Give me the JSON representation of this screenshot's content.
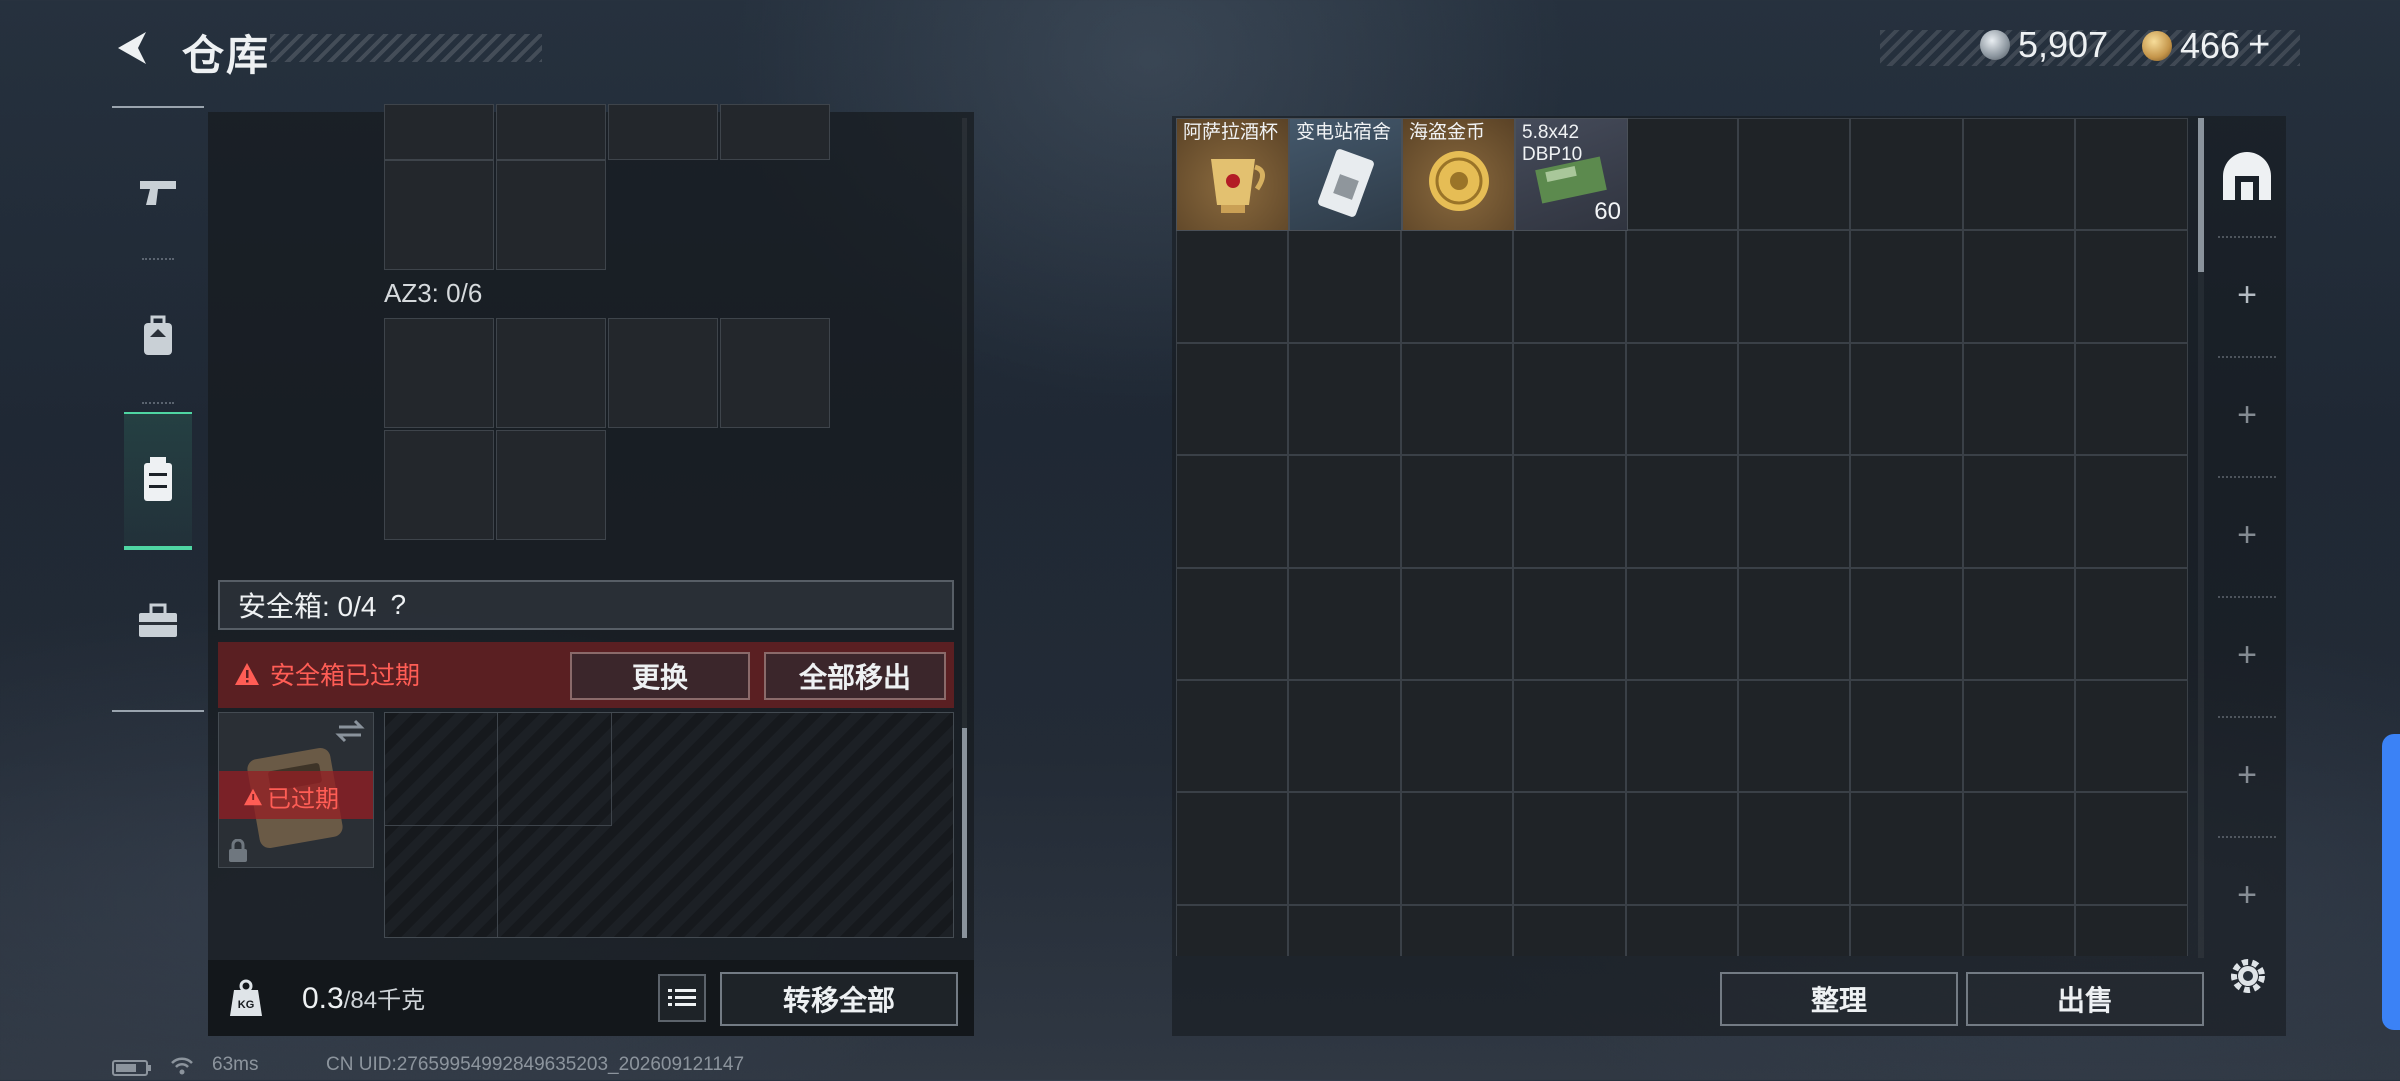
{
  "header": {
    "title": "仓库",
    "currency": [
      {
        "icon": "silver-coin-icon",
        "value": "5,907"
      },
      {
        "icon": "gold-coin-icon",
        "value": "466",
        "action": "+"
      }
    ]
  },
  "sidebar": {
    "items": [
      {
        "name": "pistol-icon",
        "active": false
      },
      {
        "name": "backpack-icon",
        "active": false
      },
      {
        "name": "safe-box-icon",
        "active": true
      },
      {
        "name": "toolbox-icon",
        "active": false
      }
    ]
  },
  "left": {
    "az_label": "AZ3: 0/6",
    "safe_box_label": "安全箱: 0/4",
    "help": "?",
    "expired_warning": "安全箱已过期",
    "replace_button": "更换",
    "remove_all_button": "全部移出",
    "case_expired_label": "已过期",
    "weight_value": "0.3",
    "weight_max": "/84千克",
    "transfer_all_button": "转移全部",
    "weight_icon_text": "KG"
  },
  "stash": {
    "items": [
      {
        "name": "阿萨拉酒杯",
        "bg": "#6b5232",
        "icon": "goblet-icon"
      },
      {
        "name": "变电站宿舍",
        "bg": "#3b4a5a",
        "icon": "keycard-icon"
      },
      {
        "name": "海盗金币",
        "bg": "#6b5232",
        "icon": "gold-coin-item-icon"
      },
      {
        "name": "5.8x42 DBP10",
        "bg": "#3a3f4c",
        "icon": "ammo-box-icon",
        "qty": "60"
      }
    ],
    "sort_button": "整理",
    "sell_button": "出售",
    "rail_plus": "+"
  },
  "status_bar": {
    "ping": "63ms",
    "uid": "CN UID:27659954992849635203_202609121147"
  },
  "colors": {
    "accent": "#4fd6a3",
    "warning": "#ff5d55",
    "expired_bg": "#5a1f22"
  }
}
